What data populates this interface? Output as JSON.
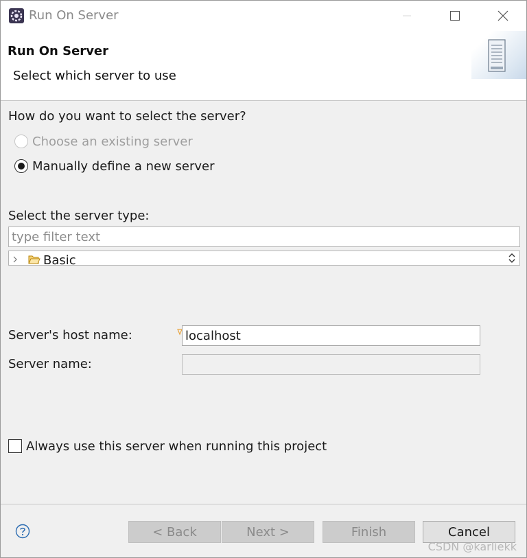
{
  "window": {
    "title": "Run On Server",
    "icon": "eclipse-gear-icon",
    "controls": [
      "minimize-icon",
      "maximize-icon",
      "close-icon"
    ]
  },
  "header": {
    "title": "Run On Server",
    "subtitle": "Select which server to use",
    "icon": "server-icon"
  },
  "selection": {
    "question": "How do you want to select the server?",
    "options": [
      {
        "label": "Choose an existing server",
        "selected": false,
        "enabled": false
      },
      {
        "label": "Manually define a new server",
        "selected": true,
        "enabled": true
      }
    ]
  },
  "server_type": {
    "label": "Select the server type:",
    "filter_placeholder": "type filter text",
    "filter_value": "",
    "tree_items": [
      {
        "label": "Basic",
        "icon": "folder-icon",
        "expanded": false
      }
    ]
  },
  "fields": {
    "host_label": "Server's host name:",
    "host_value": "localhost",
    "name_label": "Server name:",
    "name_value": ""
  },
  "always_use": {
    "label": "Always use this server when running this project",
    "checked": false
  },
  "buttons": {
    "back": "< Back",
    "next": "Next >",
    "finish": "Finish",
    "cancel": "Cancel"
  },
  "watermark": "CSDN @karliekk",
  "colors": {
    "background": "#f0f0f0",
    "disabled_text": "#9e9e9e",
    "decoration": "#e8a33d"
  }
}
